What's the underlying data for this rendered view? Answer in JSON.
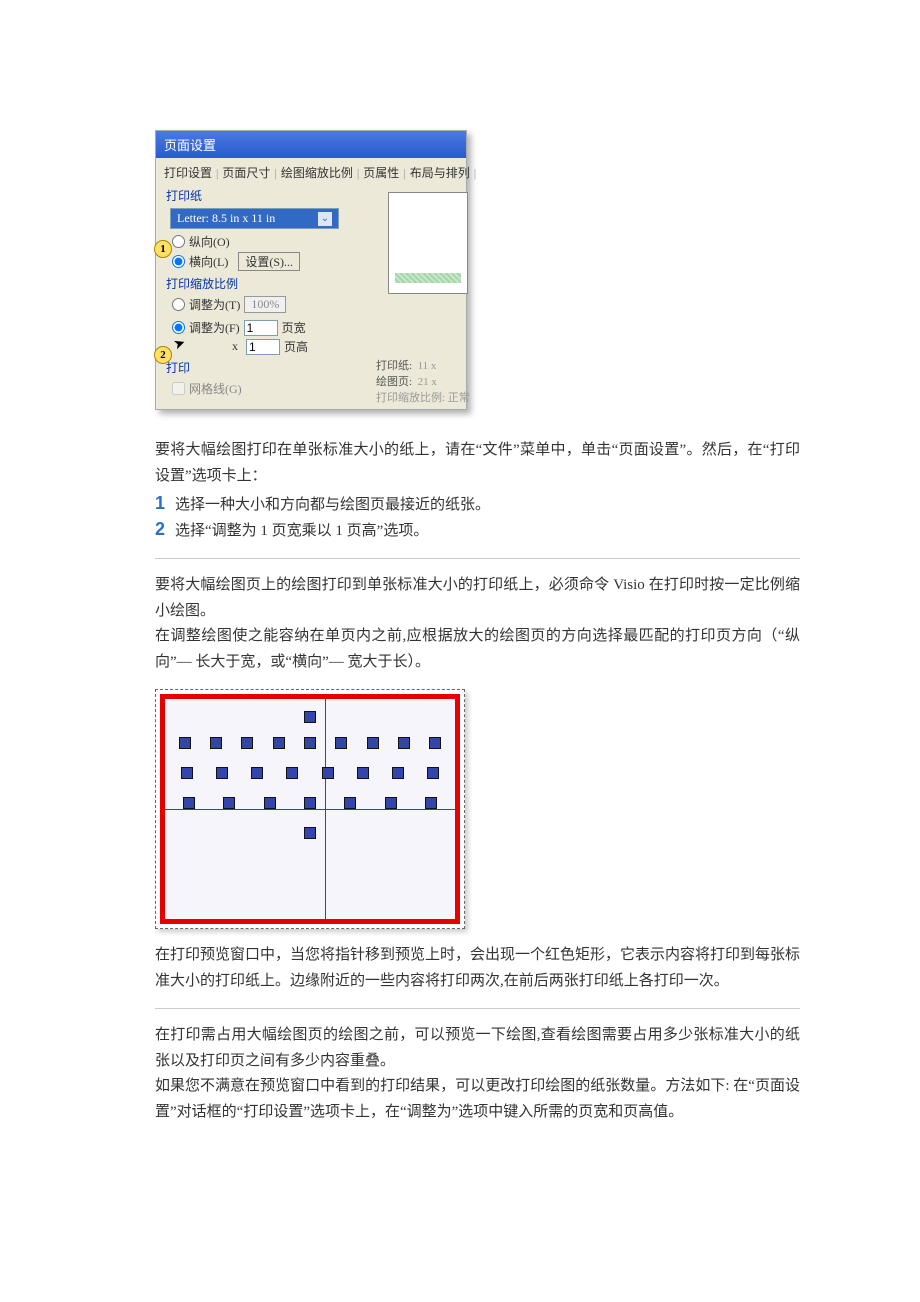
{
  "dialog": {
    "title": "页面设置",
    "tabs": [
      "打印设置",
      "页面尺寸",
      "绘图缩放比例",
      "页属性",
      "布局与排列"
    ],
    "paper_group": "打印纸",
    "paper_size": "Letter:  8.5 in x 11 in",
    "portrait": "纵向(O)",
    "landscape": "横向(L)",
    "settings_btn": "设置(S)...",
    "scale_group": "打印缩放比例",
    "adjust_to": "调整为(T)",
    "adjust_pct": "100%",
    "fit_to": "调整为(F)",
    "fit_width_val": "1",
    "fit_width_lbl": "页宽",
    "fit_height_mult": "x",
    "fit_height_val": "1",
    "fit_height_lbl": "页高",
    "print_group": "打印",
    "gridlines": "网格线(G)",
    "info_paper": "打印纸:",
    "info_paper_val": "11 x",
    "info_drawing": "绘图页:",
    "info_drawing_val": "21 x",
    "info_scale": "打印缩放比例: 正常",
    "callout1": "1",
    "callout2": "2"
  },
  "text": {
    "p1": "要将大幅绘图打印在单张标准大小的纸上，请在“文件”菜单中，单击“页面设置”。然后，在“打印设置”选项卡上：",
    "step1": "选择一种大小和方向都与绘图页最接近的纸张。",
    "step2": "选择“调整为 1 页宽乘以 1 页高”选项。",
    "p2": "要将大幅绘图页上的绘图打印到单张标准大小的打印纸上，必须命令 Visio 在打印时按一定比例缩小绘图。",
    "p3": "在调整绘图使之能容纳在单页内之前,应根据放大的绘图页的方向选择最匹配的打印页方向（“纵向”— 长大于宽，或“横向”— 宽大于长）。",
    "p4": "在打印预览窗口中，当您将指针移到预览上时，会出现一个红色矩形，它表示内容将打印到每张标准大小的打印纸上。边缘附近的一些内容将打印两次,在前后两张打印纸上各打印一次。",
    "p5": "在打印需占用大幅绘图页的绘图之前，可以预览一下绘图,查看绘图需要占用多少张标准大小的纸张以及打印页之间有多少内容重叠。",
    "p6": "如果您不满意在预览窗口中看到的打印结果，可以更改打印绘图的纸张数量。方法如下: 在“页面设置”对话框的“打印设置”选项卡上，在“调整为”选项中键入所需的页宽和页高值。",
    "n1": "1",
    "n2": "2"
  }
}
